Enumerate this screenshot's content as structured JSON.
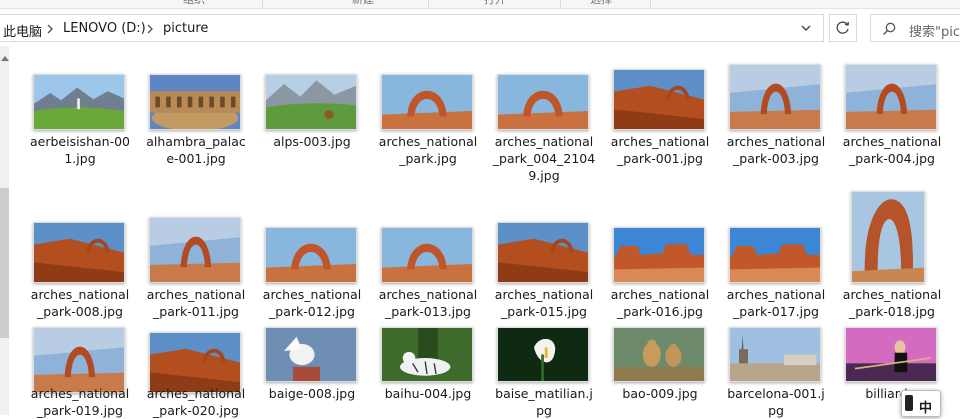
{
  "ribbon": {
    "groups": [
      "组织",
      "新建",
      "打开",
      "选择"
    ]
  },
  "address": {
    "crumbs": [
      "此电脑",
      "LENOVO (D:)",
      "picture"
    ]
  },
  "search": {
    "placeholder": "搜索\"pic..."
  },
  "ime": {
    "label": "中"
  },
  "files": [
    {
      "name": "aerbeisishan-001.jpg",
      "scene": "meadow"
    },
    {
      "name": "alhambra_palace-001.jpg",
      "scene": "palace"
    },
    {
      "name": "alps-003.jpg",
      "scene": "alps"
    },
    {
      "name": "arches_national_park.jpg",
      "scene": "arch"
    },
    {
      "name": "arches_national_park_004_21049.jpg",
      "scene": "arch"
    },
    {
      "name": "arches_national_park-001.jpg",
      "scene": "rock"
    },
    {
      "name": "arches_national_park-003.jpg",
      "scene": "archsky"
    },
    {
      "name": "arches_national_park-004.jpg",
      "scene": "archsky"
    },
    {
      "name": "arches_national_park-008.jpg",
      "scene": "rock"
    },
    {
      "name": "arches_national_park-011.jpg",
      "scene": "archsky"
    },
    {
      "name": "arches_national_park-012.jpg",
      "scene": "arch"
    },
    {
      "name": "arches_national_park-013.jpg",
      "scene": "arch"
    },
    {
      "name": "arches_national_park-015.jpg",
      "scene": "rock"
    },
    {
      "name": "arches_national_park-016.jpg",
      "scene": "mesa"
    },
    {
      "name": "arches_national_park-017.jpg",
      "scene": "mesa"
    },
    {
      "name": "arches_national_park-018.jpg",
      "scene": "tall"
    },
    {
      "name": "arches_national_park-019.jpg",
      "scene": "archsky"
    },
    {
      "name": "arches_national_park-020.jpg",
      "scene": "rock"
    },
    {
      "name": "baige-008.jpg",
      "scene": "bird"
    },
    {
      "name": "baihu-004.jpg",
      "scene": "tiger"
    },
    {
      "name": "baise_matilian.jpg",
      "scene": "lily"
    },
    {
      "name": "bao-009.jpg",
      "scene": "cheetah"
    },
    {
      "name": "barcelona-001.jpg",
      "scene": "city"
    },
    {
      "name": "billiards-",
      "scene": "pool"
    }
  ],
  "name_lines": [
    [
      "aerbeisishan-00",
      "1.jpg"
    ],
    [
      "alhambra_palac",
      "e-001.jpg"
    ],
    [
      "alps-003.jpg"
    ],
    [
      "arches_national",
      "_park.jpg"
    ],
    [
      "arches_national",
      "_park_004_2104",
      "9.jpg"
    ],
    [
      "arches_national",
      "_park-001.jpg"
    ],
    [
      "arches_national",
      "_park-003.jpg"
    ],
    [
      "arches_national",
      "_park-004.jpg"
    ],
    [
      "arches_national",
      "_park-008.jpg"
    ],
    [
      "arches_national",
      "_park-011.jpg"
    ],
    [
      "arches_national",
      "_park-012.jpg"
    ],
    [
      "arches_national",
      "_park-013.jpg"
    ],
    [
      "arches_national",
      "_park-015.jpg"
    ],
    [
      "arches_national",
      "_park-016.jpg"
    ],
    [
      "arches_national",
      "_park-017.jpg"
    ],
    [
      "arches_national",
      "_park-018.jpg"
    ],
    [
      "arches_national",
      "_park-019.jpg"
    ],
    [
      "arches_national",
      "_park-020.jpg"
    ],
    [
      "baige-008.jpg"
    ],
    [
      "baihu-004.jpg"
    ],
    [
      "baise_matilian.j",
      "pg"
    ],
    [
      "bao-009.jpg"
    ],
    [
      "barcelona-001.j",
      "pg"
    ],
    [
      "billiards-"
    ]
  ],
  "colors": {
    "selection": "#cce8ff",
    "border": "#d9d9d9"
  }
}
